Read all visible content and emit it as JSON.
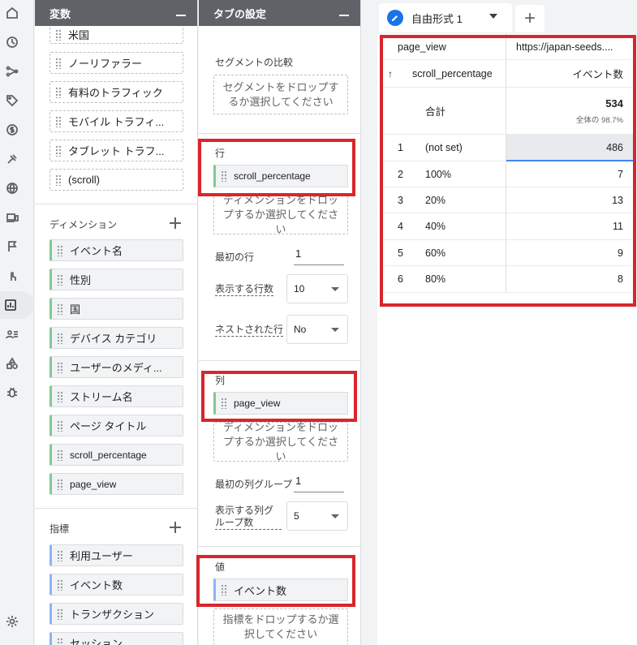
{
  "variables_panel": {
    "title": "変数",
    "segments": [
      "米国",
      "ノーリファラー",
      "有料のトラフィック",
      "モバイル トラフィ...",
      "タブレット トラフ...",
      "(scroll)"
    ],
    "dimensions_label": "ディメンション",
    "dimensions": [
      "イベント名",
      "性別",
      "国",
      "デバイス カテゴリ",
      "ユーザーのメディ...",
      "ストリーム名",
      "ページ タイトル",
      "scroll_percentage",
      "page_view"
    ],
    "metrics_label": "指標",
    "metrics": [
      "利用ユーザー",
      "イベント数",
      "トランザクション",
      "セッション"
    ]
  },
  "tab_settings": {
    "title": "タブの設定",
    "segment_compare_label": "セグメントの比較",
    "segment_drop_text": "セグメントをドロップするか選択してください",
    "rows_label": "行",
    "rows_chip": "scroll_percentage",
    "dimension_drop_text": "ディメンションをドロップするか選択してください",
    "first_row_label": "最初の行",
    "first_row_value": "1",
    "rows_shown_label": "表示する行数",
    "rows_shown_value": "10",
    "nested_rows_label": "ネストされた行",
    "nested_rows_value": "No",
    "columns_label": "列",
    "columns_chip": "page_view",
    "first_col_group_label": "最初の列グループ",
    "first_col_group_value": "1",
    "col_groups_shown_label": "表示する列グループ数",
    "col_groups_shown_value": "5",
    "values_label": "値",
    "values_chip": "イベント数",
    "metric_drop_text": "指標をドロップするか選択してください"
  },
  "report": {
    "tab_label": "自由形式 1",
    "add_tab": "+",
    "header": {
      "column_dim_label": "page_view",
      "column_value": "https://japan-seeds....",
      "sort_arrow": "↑",
      "row_dim_label": "scroll_percentage",
      "metric_label": "イベント数"
    },
    "total_label": "合計",
    "total_value": "534",
    "total_share": "全体の 98.7%",
    "rows": [
      {
        "index": "1",
        "dimension": "(not set)",
        "value": "486"
      },
      {
        "index": "2",
        "dimension": "100%",
        "value": "7"
      },
      {
        "index": "3",
        "dimension": "20%",
        "value": "13"
      },
      {
        "index": "4",
        "dimension": "40%",
        "value": "11"
      },
      {
        "index": "5",
        "dimension": "60%",
        "value": "9"
      },
      {
        "index": "6",
        "dimension": "80%",
        "value": "8"
      }
    ]
  },
  "colors": {
    "highlight": "#d7262c",
    "panel_header": "#5f6368",
    "accent": "#1a73e8",
    "dimension_chip_border": "#81c995",
    "metric_chip_border": "#8ab4f8"
  }
}
